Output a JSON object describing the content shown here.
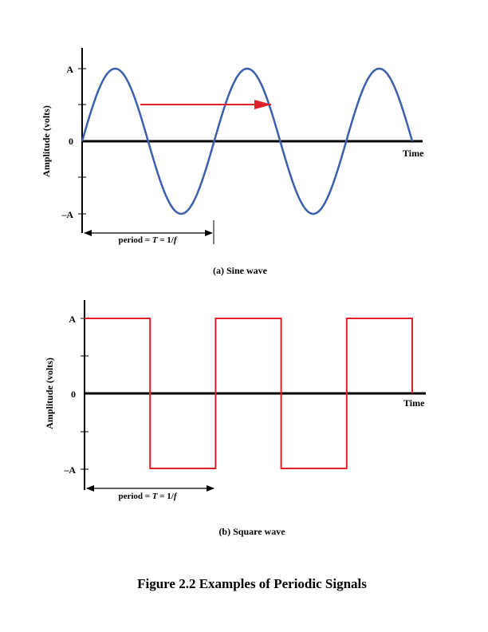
{
  "colors": {
    "sine_curve": "#3b5faa",
    "square_curve": "#e0202a",
    "arrow": "#e0202a",
    "axis": "#000000"
  },
  "panel_a": {
    "caption": "(a) Sine wave",
    "ylabel": "Amplitude (volts)",
    "xlabel": "Time",
    "ticks": {
      "top": "A",
      "zero": "0",
      "bottom": "–A"
    },
    "period_label": {
      "prefix": "period = ",
      "T": "T",
      "mid": " = 1/",
      "f": "f"
    },
    "waveform": {
      "type": "sine",
      "periods": 2.5,
      "amplitude": 1
    }
  },
  "panel_b": {
    "caption": "(b) Square wave",
    "ylabel": "Amplitude (volts)",
    "xlabel": "Time",
    "ticks": {
      "top": "A",
      "zero": "0",
      "bottom": "–A"
    },
    "period_label": {
      "prefix": "period = ",
      "T": "T",
      "mid": " = 1/",
      "f": "f"
    },
    "waveform": {
      "type": "square",
      "periods": 2.5,
      "amplitude": 1
    }
  },
  "figure_caption": "Figure 2.2 Examples of Periodic Signals"
}
